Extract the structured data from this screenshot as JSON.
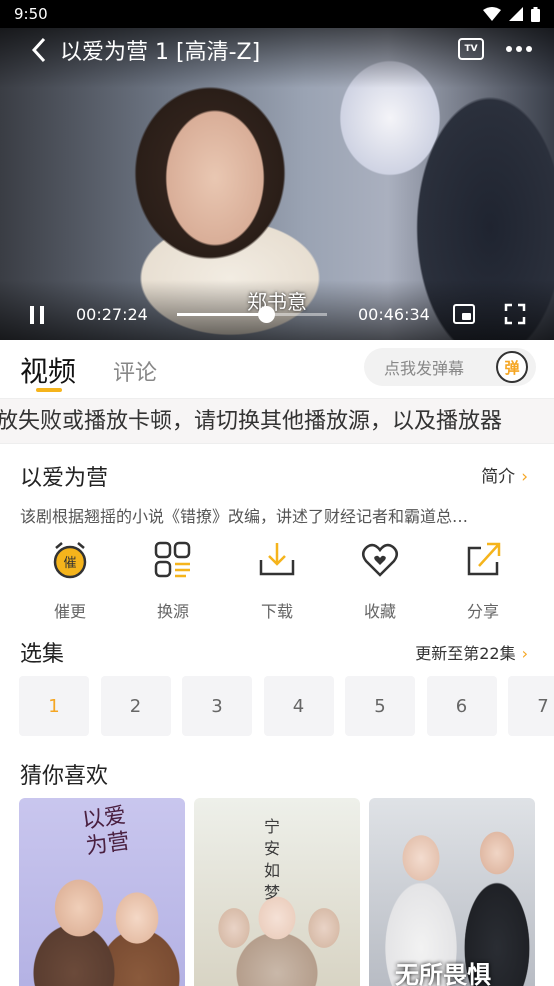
{
  "status_bar": {
    "time": "9:50"
  },
  "player": {
    "title": "以爱为营 1 [高清-Z]",
    "tv_label": "TV",
    "subtitle": "郑书意",
    "current_time": "00:27:24",
    "total_time": "00:46:34",
    "progress": 0.59
  },
  "tabs": {
    "video": "视频",
    "comment": "评论"
  },
  "danmu": {
    "placeholder": "点我发弹幕",
    "button": "弹"
  },
  "marquee": "放失败或播放卡顿，请切换其他播放源，以及播放器",
  "info": {
    "title": "以爱为营",
    "intro_label": "简介",
    "description": "该剧根据翘摇的小说《错撩》改编，讲述了财经记者和霸道总…"
  },
  "actions": [
    {
      "label": "催更",
      "icon": "alarm-icon"
    },
    {
      "label": "换源",
      "icon": "switch-source-icon"
    },
    {
      "label": "下载",
      "icon": "download-icon"
    },
    {
      "label": "收藏",
      "icon": "heart-icon"
    },
    {
      "label": "分享",
      "icon": "share-icon"
    }
  ],
  "episodes": {
    "title": "选集",
    "update_text": "更新至第22集",
    "items": [
      "1",
      "2",
      "3",
      "4",
      "5",
      "6",
      "7"
    ],
    "selected": "1"
  },
  "recommend": {
    "title": "猜你喜欢",
    "posters": [
      {
        "caption": "以爱为营"
      },
      {
        "caption": "宁安如梦"
      },
      {
        "caption": "无所畏惧"
      }
    ]
  },
  "colors": {
    "accent": "#f5a623",
    "text": "#222222",
    "muted": "#888888"
  }
}
